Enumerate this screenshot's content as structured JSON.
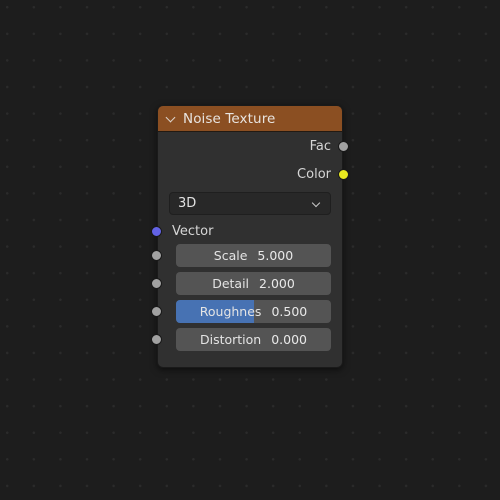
{
  "editor": {
    "name": "blender-shader-node-editor",
    "background_color": "#1d1d1d",
    "grid_dot_color": "#2b2b2b"
  },
  "node": {
    "title": "Noise Texture",
    "header_color": "#8b4f22",
    "body_color": "#303030",
    "collapse_icon": "chevron-down-icon",
    "outputs": [
      {
        "label": "Fac",
        "socket_color": "#a1a1a1",
        "socket_type": "float"
      },
      {
        "label": "Color",
        "socket_color": "#e8e81f",
        "socket_type": "color"
      }
    ],
    "dimension_dropdown": {
      "value": "3D",
      "chevron_icon": "chevron-down-icon"
    },
    "inputs": [
      {
        "label": "Vector",
        "socket_color": "#6363e6",
        "socket_type": "vector"
      }
    ],
    "properties": [
      {
        "label": "Scale",
        "value": "5.000",
        "fill_percent": 0,
        "socket_color": "#a1a1a1"
      },
      {
        "label": "Detail",
        "value": "2.000",
        "fill_percent": 0,
        "socket_color": "#a1a1a1"
      },
      {
        "label": "Roughnes",
        "value": "0.500",
        "fill_percent": 50,
        "socket_color": "#a1a1a1",
        "fill_color": "#4772b3"
      },
      {
        "label": "Distortion",
        "value": "0.000",
        "fill_percent": 0,
        "socket_color": "#a1a1a1"
      }
    ]
  }
}
